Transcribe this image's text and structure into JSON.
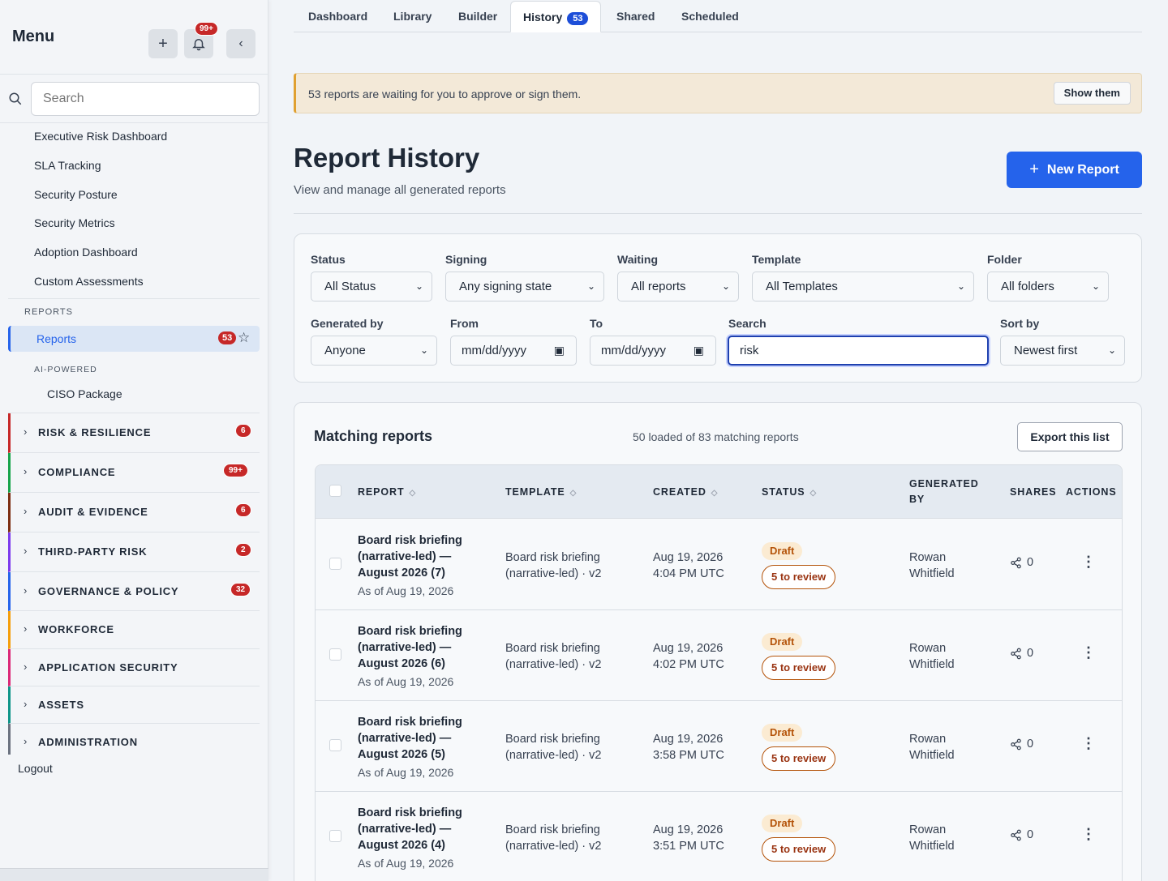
{
  "sidebar": {
    "title": "Menu",
    "notif_count": "99+",
    "search_placeholder": "Search",
    "links": [
      "Executive Risk Dashboard",
      "SLA Tracking",
      "Security Posture",
      "Security Metrics",
      "Adoption Dashboard",
      "Custom Assessments"
    ],
    "reports_section": "REPORTS",
    "reports_label": "Reports",
    "reports_badge": "53",
    "ai_section": "AI-POWERED",
    "ciso_label": "CISO Package",
    "groups": [
      {
        "label": "RISK & RESILIENCE",
        "badge": "6",
        "color": "#c62828"
      },
      {
        "label": "COMPLIANCE",
        "badge": "99+",
        "color": "#16a34a"
      },
      {
        "label": "AUDIT & EVIDENCE",
        "badge": "6",
        "color": "#7c2d12"
      },
      {
        "label": "THIRD-PARTY RISK",
        "badge": "2",
        "color": "#7c3aed"
      },
      {
        "label": "GOVERNANCE & POLICY",
        "badge": "32",
        "color": "#2563eb"
      },
      {
        "label": "WORKFORCE",
        "badge": "",
        "color": "#f59e0b"
      },
      {
        "label": "APPLICATION SECURITY",
        "badge": "",
        "color": "#db2777"
      },
      {
        "label": "ASSETS",
        "badge": "",
        "color": "#0d9488"
      },
      {
        "label": "ADMINISTRATION",
        "badge": "",
        "color": "#6b7280"
      }
    ],
    "logout": "Logout"
  },
  "tabs": [
    {
      "label": "Dashboard"
    },
    {
      "label": "Library"
    },
    {
      "label": "Builder"
    },
    {
      "label": "History",
      "badge": "53"
    },
    {
      "label": "Shared"
    },
    {
      "label": "Scheduled"
    }
  ],
  "alert": {
    "text": "53 reports are waiting for you to approve or sign them.",
    "button": "Show them"
  },
  "page": {
    "title": "Report History",
    "subtitle": "View and manage all generated reports",
    "new_button": "New Report"
  },
  "filters": {
    "status": {
      "label": "Status",
      "value": "All Status"
    },
    "signing": {
      "label": "Signing",
      "value": "Any signing state"
    },
    "waiting": {
      "label": "Waiting",
      "value": "All reports"
    },
    "template": {
      "label": "Template",
      "value": "All Templates"
    },
    "folder": {
      "label": "Folder",
      "value": "All folders"
    },
    "generated_by": {
      "label": "Generated by",
      "value": "Anyone"
    },
    "from": {
      "label": "From",
      "value": "mm/dd/yyyy"
    },
    "to": {
      "label": "To",
      "value": "mm/dd/yyyy"
    },
    "search": {
      "label": "Search",
      "value": "risk"
    },
    "sort": {
      "label": "Sort by",
      "value": "Newest first"
    }
  },
  "results": {
    "title": "Matching reports",
    "count": "50 loaded of 83 matching reports",
    "export": "Export this list",
    "columns": {
      "report": "REPORT",
      "template": "TEMPLATE",
      "created": "CREATED",
      "status": "STATUS",
      "generated_by_1": "GENERATED",
      "generated_by_2": "BY",
      "shares": "SHARES",
      "actions": "ACTIONS"
    },
    "rows": [
      {
        "name_1": "Board risk briefing",
        "name_2": "(narrative-led) —",
        "name_3": "August 2026 (7)",
        "as_of": "As of Aug 19, 2026",
        "tmpl_1": "Board risk briefing",
        "tmpl_2": "(narrative-led) · v2",
        "date": "Aug 19, 2026",
        "time": "4:04 PM UTC",
        "status": "Draft",
        "review": "5 to review",
        "gen_1": "Rowan",
        "gen_2": "Whitfield",
        "shares": "0"
      },
      {
        "name_1": "Board risk briefing",
        "name_2": "(narrative-led) —",
        "name_3": "August 2026 (6)",
        "as_of": "As of Aug 19, 2026",
        "tmpl_1": "Board risk briefing",
        "tmpl_2": "(narrative-led) · v2",
        "date": "Aug 19, 2026",
        "time": "4:02 PM UTC",
        "status": "Draft",
        "review": "5 to review",
        "gen_1": "Rowan",
        "gen_2": "Whitfield",
        "shares": "0"
      },
      {
        "name_1": "Board risk briefing",
        "name_2": "(narrative-led) —",
        "name_3": "August 2026 (5)",
        "as_of": "As of Aug 19, 2026",
        "tmpl_1": "Board risk briefing",
        "tmpl_2": "(narrative-led) · v2",
        "date": "Aug 19, 2026",
        "time": "3:58 PM UTC",
        "status": "Draft",
        "review": "5 to review",
        "gen_1": "Rowan",
        "gen_2": "Whitfield",
        "shares": "0"
      },
      {
        "name_1": "Board risk briefing",
        "name_2": "(narrative-led) —",
        "name_3": "August 2026 (4)",
        "as_of": "As of Aug 19, 2026",
        "tmpl_1": "Board risk briefing",
        "tmpl_2": "(narrative-led) · v2",
        "date": "Aug 19, 2026",
        "time": "3:51 PM UTC",
        "status": "Draft",
        "review": "5 to review",
        "gen_1": "Rowan",
        "gen_2": "Whitfield",
        "shares": "0"
      }
    ]
  }
}
